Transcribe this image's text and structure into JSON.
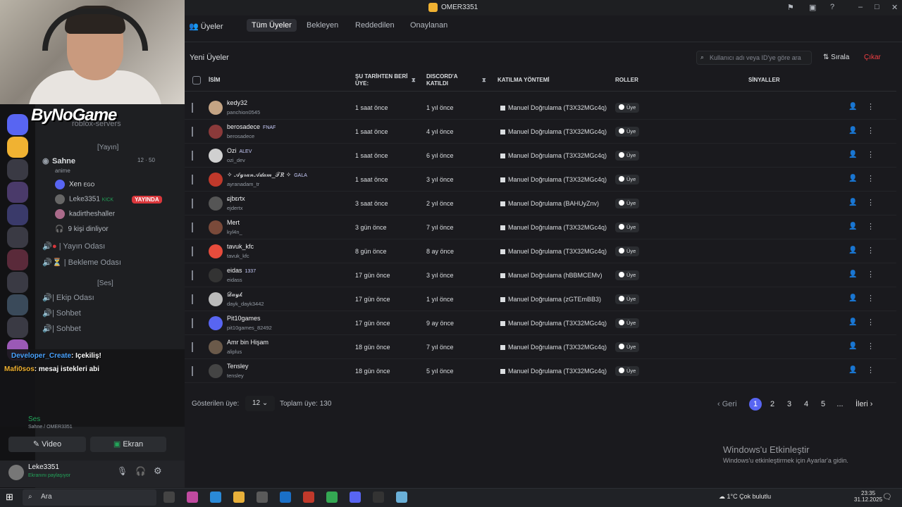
{
  "window": {
    "title": "OMER3351"
  },
  "sidebar": {
    "brand": "ByNoGame",
    "brand_sub": "roblox-servers",
    "category_stage": "[Yayın]",
    "stage_name": "Sahne",
    "stage_sub": "anime",
    "stage_counts": [
      "12",
      "50"
    ],
    "stage_members": [
      {
        "name": "Xen",
        "tag": "EGO"
      },
      {
        "name": "Leke3351",
        "tag": "KICK",
        "live": "YAYINDA"
      },
      {
        "name": "kadirtheshaller"
      }
    ],
    "listeners": "9 kişi dinliyor",
    "channels_a": [
      "| Yayın Odası",
      "| Bekleme Odası"
    ],
    "category_voice": "[Ses]",
    "channels_b": [
      "| Ekip Odası",
      "| Sohbet",
      "| Sohbet"
    ],
    "chat": [
      {
        "user": "Developer_Create",
        "text": ": Içekiliş!"
      },
      {
        "user": "Mafi0sos",
        "text": ": mesaj istekleri abi"
      }
    ],
    "voice_status": "Ses",
    "voice_sub": "Sahne / OMER3351",
    "video_label": "Video",
    "screen_label": "Ekran",
    "user_name": "Leke3351",
    "user_status": "Ekranını paylaşıyor"
  },
  "tabs": {
    "title": "Üyeler",
    "items": [
      "Tüm Üyeler",
      "Bekleyen",
      "Reddedilen",
      "Onaylanan"
    ]
  },
  "section_title": "Yeni Üyeler",
  "search": {
    "placeholder": "Kullanıcı adı veya ID'ye göre ara"
  },
  "sort_label": "Sırala",
  "exit_label": "Çıkar",
  "columns": {
    "name": "İSİM",
    "since_1": "ŞU TARİHTEN BERİ",
    "since_2": "ÜYE:",
    "discord_1": "DISCORD'A",
    "discord_2": "KATILDI",
    "method": "KATILMA YÖNTEMİ",
    "roles": "ROLLER",
    "signals": "SİNYALLER"
  },
  "members": [
    {
      "name": "kedy32",
      "user": "panchion0545",
      "tag": "",
      "since": "1 saat önce",
      "joined": "1 yıl önce",
      "method": "Manuel Doğrulama (T3X32MGc4q)",
      "role": "Üye",
      "color": "#c4a484"
    },
    {
      "name": "berosadece",
      "user": "berosadece",
      "tag": "FNAF",
      "since": "1 saat önce",
      "joined": "4 yıl önce",
      "method": "Manuel Doğrulama (T3X32MGc4q)",
      "role": "Üye",
      "color": "#8b3a3a"
    },
    {
      "name": "Ozi",
      "user": "ozi_dev",
      "tag": "ALEV",
      "since": "1 saat önce",
      "joined": "6 yıl önce",
      "method": "Manuel Doğrulama (T3X32MGc4q)",
      "role": "Üye",
      "color": "#d0d0d0"
    },
    {
      "name": "✧ 𝒜𝓎𝓇𝒶𝓃𝒜𝒹𝒶𝓂_𝒯𝑅 ✧",
      "user": "ayranadam_tr",
      "tag": "GALA",
      "since": "1 saat önce",
      "joined": "3 yıl önce",
      "method": "Manuel Doğrulama (T3X32MGc4q)",
      "role": "Üye",
      "color": "#c0392b"
    },
    {
      "name": "ɕjbɛɾtx",
      "user": "ejdertx",
      "tag": "",
      "since": "3 saat önce",
      "joined": "2 yıl önce",
      "method": "Manuel Doğrulama (BAHUyZnv)",
      "role": "Üye",
      "color": "#555"
    },
    {
      "name": "Mert",
      "user": "kyl4n_",
      "tag": "",
      "since": "3 gün önce",
      "joined": "7 yıl önce",
      "method": "Manuel Doğrulama (T3X32MGc4q)",
      "role": "Üye",
      "color": "#7a4a3a"
    },
    {
      "name": "tavuk_kfc",
      "user": "tavuk_kfc",
      "tag": "",
      "since": "8 gün önce",
      "joined": "8 ay önce",
      "method": "Manuel Doğrulama (T3X32MGc4q)",
      "role": "Üye",
      "color": "#e74c3c"
    },
    {
      "name": "eidas",
      "user": "eidass",
      "tag": "1337",
      "since": "17 gün önce",
      "joined": "3 yıl önce",
      "method": "Manuel Doğrulama (hBBMCEMv)",
      "role": "Üye",
      "color": "#333"
    },
    {
      "name": "𝒟𝒶𝓎𝓀",
      "user": "dayk_dayk3442",
      "tag": "",
      "since": "17 gün önce",
      "joined": "1 yıl önce",
      "method": "Manuel Doğrulama (zGTEmBB3)",
      "role": "Üye",
      "color": "#bbb"
    },
    {
      "name": "Pit10games",
      "user": "pit10games_82492",
      "tag": "",
      "since": "17 gün önce",
      "joined": "9 ay önce",
      "method": "Manuel Doğrulama (T3X32MGc4q)",
      "role": "Üye",
      "color": "#5865f2"
    },
    {
      "name": "Amr bin Hişam",
      "user": "aliplus",
      "tag": "",
      "since": "18 gün önce",
      "joined": "7 yıl önce",
      "method": "Manuel Doğrulama (T3X32MGc4q)",
      "role": "Üye",
      "color": "#6b5a4a"
    },
    {
      "name": "Tensley",
      "user": "tensley",
      "tag": "",
      "since": "18 gün önce",
      "joined": "5 yıl önce",
      "method": "Manuel Doğrulama (T3X32MGc4q)",
      "role": "Üye",
      "color": "#444"
    }
  ],
  "footer": {
    "shown_label": "Gösterilen üye:",
    "shown_value": "12",
    "total": "Toplam üye: 130",
    "prev": "Geri",
    "pages": [
      "1",
      "2",
      "3",
      "4",
      "5"
    ],
    "ellipsis": "...",
    "next": "İleri"
  },
  "watermark": {
    "line1": "Windows'u Etkinleştir",
    "line2": "Windows'u etkinleştirmek için Ayarlar'a gidin."
  },
  "taskbar": {
    "search": "Ara",
    "weather": "1°C  Çok bulutlu",
    "time": "23:35",
    "date": "31.12.2025"
  }
}
